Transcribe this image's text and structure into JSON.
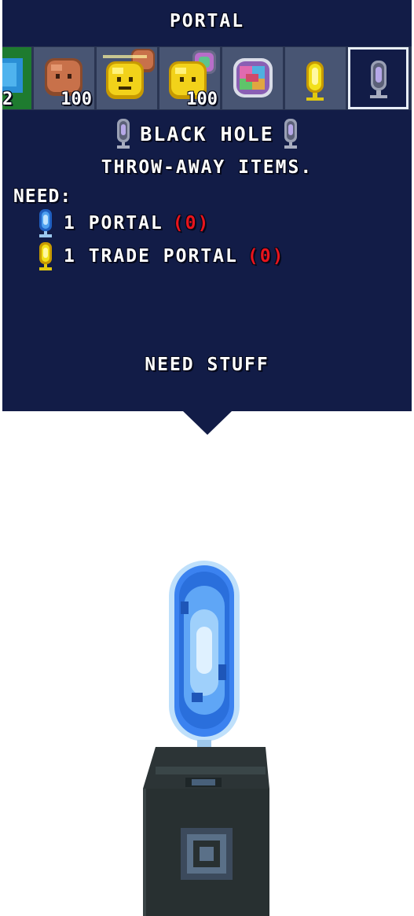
{
  "panel": {
    "title": "PORTAL",
    "tabs": [
      {
        "name": "green-block",
        "count": "2",
        "selected": false
      },
      {
        "name": "brown-face",
        "count": "100",
        "selected": false
      },
      {
        "name": "yellow-face-brown",
        "count": "",
        "selected": false
      },
      {
        "name": "yellow-face-rainbow",
        "count": "100",
        "selected": false
      },
      {
        "name": "rainbow-face",
        "count": "",
        "selected": false
      },
      {
        "name": "trade-portal",
        "count": "",
        "selected": false
      },
      {
        "name": "black-hole",
        "count": "",
        "selected": true
      }
    ],
    "item": {
      "name": "BLACK HOLE",
      "description": "THROW-AWAY ITEMS.",
      "need_label": "NEED:",
      "requirements": [
        {
          "qty_name": "1 PORTAL",
          "have": "(0)",
          "icon": "blue-portal-icon"
        },
        {
          "qty_name": "1 TRADE PORTAL",
          "have": "(0)",
          "icon": "gold-portal-icon"
        }
      ]
    },
    "action_label": "NEED STUFF"
  },
  "colors": {
    "panel_bg": "#121c47",
    "tab_bg": "#485573",
    "missing_red": "#e8141c",
    "portal_blue": "#3b82f0"
  }
}
